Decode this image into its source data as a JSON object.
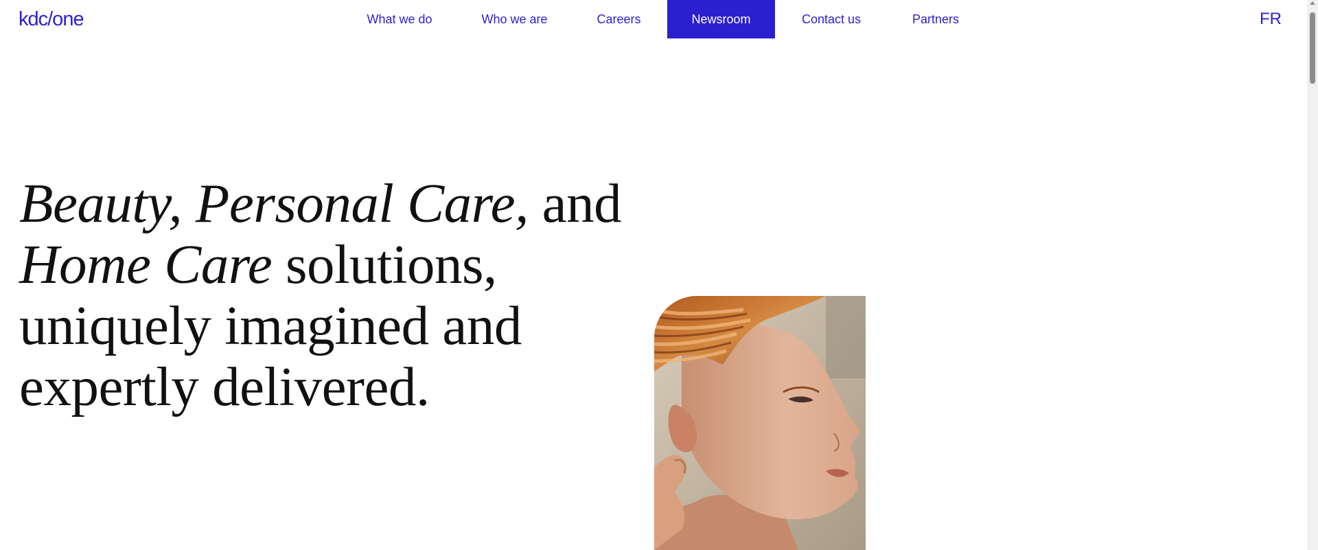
{
  "header": {
    "logo_text": "kdc/one",
    "nav": [
      {
        "label": "What we do",
        "active": false
      },
      {
        "label": "Who we are",
        "active": false
      },
      {
        "label": "Careers",
        "active": false
      },
      {
        "label": "Newsroom",
        "active": true
      },
      {
        "label": "Contact us",
        "active": false
      },
      {
        "label": "Partners",
        "active": false
      }
    ],
    "language_label": "FR"
  },
  "hero": {
    "title_parts": [
      {
        "text": "Beauty, Personal Care,",
        "italic": true
      },
      {
        "text": " and",
        "italic": false
      },
      {
        "text": "Home Care",
        "italic": true
      },
      {
        "text": " solutions,",
        "italic": false
      },
      {
        "text": "uniquely imagined and",
        "italic": false
      },
      {
        "text": "expertly delivered.",
        "italic": false
      }
    ]
  },
  "colors": {
    "brand": "#2b1fd0",
    "text": "#111111",
    "background": "#ffffff"
  }
}
